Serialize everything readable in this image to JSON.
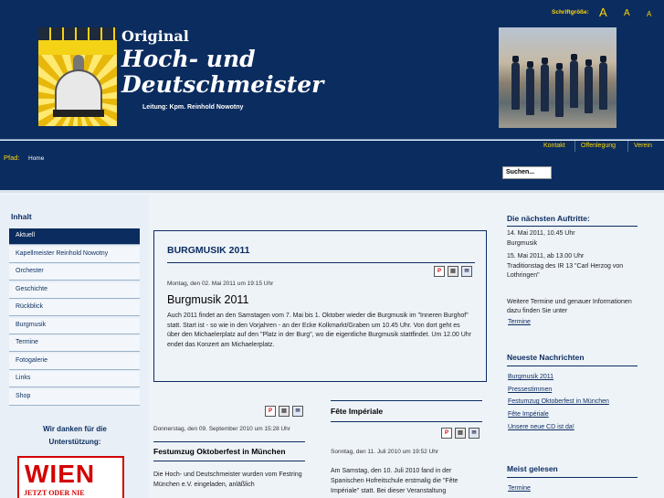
{
  "header": {
    "logo": {
      "line1": "Original",
      "line2": "Hoch- und",
      "line3": "Deutschmeister",
      "leitung": "Leitung: Kpm. Reinhold Nowotny"
    },
    "fontsize": {
      "label": "Schriftgröße:",
      "large": "A",
      "medium": "A",
      "small": "A"
    }
  },
  "toplinks": [
    "Kontakt",
    "Offenlegung",
    "Verein"
  ],
  "breadcrumb": {
    "label": "Pfad:",
    "home": "Home"
  },
  "search": {
    "value": "Suchen..."
  },
  "sidebar": {
    "title": "Inhalt",
    "items": [
      {
        "label": "Aktuell"
      },
      {
        "label": "Kapellmeister Reinhold Nowotny"
      },
      {
        "label": "Orchester"
      },
      {
        "label": "Geschichte"
      },
      {
        "label": "Rückblick"
      },
      {
        "label": "Burgmusik"
      },
      {
        "label": "Termine"
      },
      {
        "label": "Fotogalerie"
      },
      {
        "label": "Links"
      },
      {
        "label": "Shop"
      }
    ],
    "thanks": "Wir danken für die Unterstützung:",
    "sponsor": {
      "big": "WIEN",
      "small": "JETZT ODER NIE"
    }
  },
  "main_article": {
    "title": "BURGMUSIK 2011",
    "date": "Montag, den 02. Mai 2011 um 19:15 Uhr",
    "heading": "Burgmusik 2011",
    "text": "Auch 2011 findet an den Samstagen vom 7. Mai bis 1. Oktober wieder die Burgmusik im \"Inneren Burghof\" statt. Start ist - so wie in den Vorjahren - an der Ecke Kolkmarkt/Graben um 10.45 Uhr. Von dort geht es über den Michaelerplatz auf den \"Platz in der Burg\", wo die eigentliche Burgmusik stattfindet. Um 12.00 Uhr endet das Konzert am Michaelerplatz."
  },
  "article_left": {
    "date": "Donnerstag, den 09. September 2010 um 15:28 Uhr",
    "title": "Festumzug Oktoberfest in München",
    "text": "Die Hoch- und Deutschmeister wurden vom Festring München e.V. eingeladen, anläßlich"
  },
  "article_right": {
    "title": "Fête Impériale",
    "date": "Sonntag, den 11. Juli 2010 um 19:52 Uhr",
    "text": "Am Samstag, den 10. Juli 2010 fand in der Spanischen Hofreitschule erstmalig die \"Fête Impériale\" statt. Bei dieser Veranstaltung"
  },
  "right": {
    "auftritte": {
      "title": "Die nächsten Auftritte:",
      "e1_date": "14. Mai 2011, 10.45 Uhr",
      "e1_place": "Burgmusik",
      "e2_date": "15. Mai 2011, ab 13.00 Uhr",
      "e2_place": "Traditionstag des IR 13 \"Carl Herzog von Lothringen\"",
      "more": "Weitere Termine und genauer Informationen dazu finden Sie unter",
      "more_link": "Termine"
    },
    "news": {
      "title": "Neueste Nachrichten",
      "items": [
        "Burgmusik 2011",
        "Pressestimmen",
        "Festumzug Oktoberfest in München",
        "Fête Impériale",
        "Unsere neue CD ist da!"
      ]
    },
    "meist": {
      "title": "Meist gelesen",
      "items": [
        "Termine"
      ]
    }
  },
  "colors": {
    "navy": "#0b2c5f",
    "gold": "#ffd700",
    "logo_yellow": "#f4d215"
  }
}
